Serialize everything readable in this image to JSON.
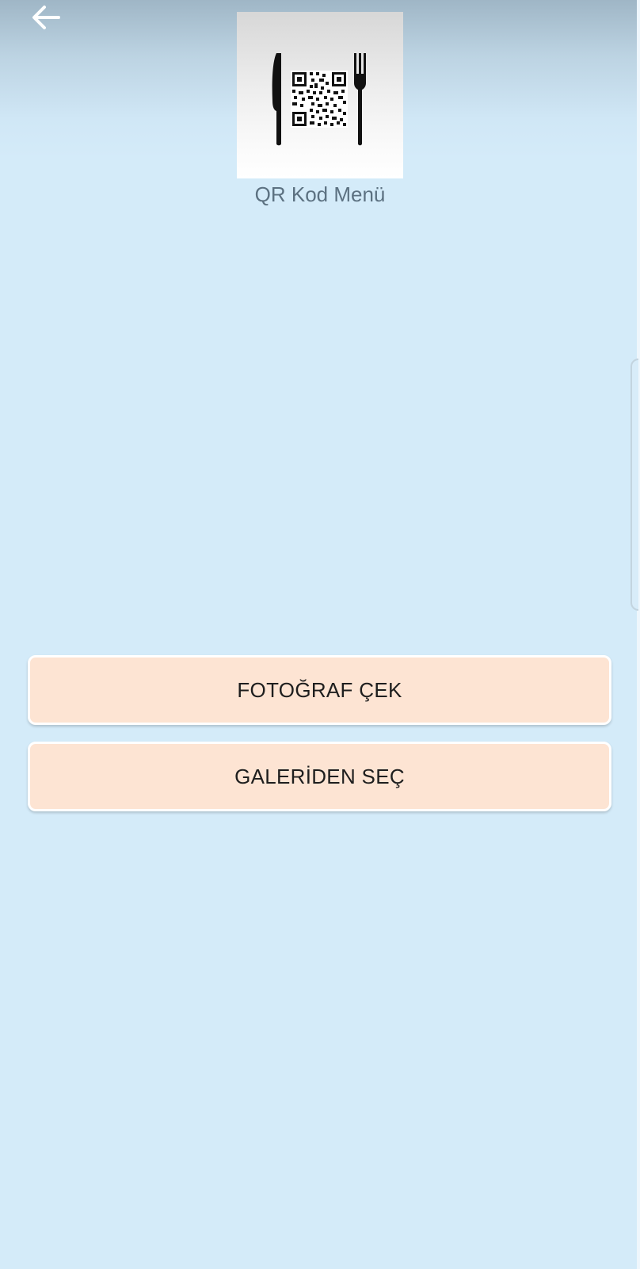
{
  "app": {
    "title": "QR Kod Menü",
    "logo_icon": "qr-menu-cutlery-logo"
  },
  "nav": {
    "back_icon": "arrow-left-icon"
  },
  "actions": {
    "take_photo_label": "FOTOĞRAF ÇEK",
    "choose_gallery_label": "GALERİDEN SEÇ"
  },
  "colors": {
    "background": "#d4ebf9",
    "button_fill": "#fde4d3",
    "title_text": "#5c7181"
  }
}
